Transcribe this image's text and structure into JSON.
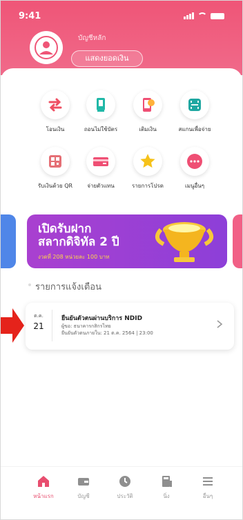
{
  "status_bar": {
    "time": "9:41"
  },
  "account": {
    "label": "บัญชีหลัก",
    "show_balance_button": "แสดงยอดเงิน"
  },
  "menu_items": [
    {
      "label": "โอนเงิน",
      "icon": "transfer-icon",
      "color": "#ef4f62"
    },
    {
      "label": "ถอนไม่ใช้บัตร",
      "icon": "cardless-withdraw-icon",
      "color": "#20b8a7"
    },
    {
      "label": "เติมเงิน",
      "icon": "topup-phone-icon",
      "color": "#ff7d4a"
    },
    {
      "label": "สแกนเพื่อจ่าย",
      "icon": "scan-to-pay-icon",
      "color": "#1fa7a1"
    },
    {
      "label": "รับเงินด้วย QR",
      "icon": "qr-receive-icon",
      "color": "#e56f75"
    },
    {
      "label": "จ่ายตัวแทน",
      "icon": "bill-pay-icon",
      "color": "#ef4f74"
    },
    {
      "label": "รายการโปรด",
      "icon": "star-icon",
      "color": "#f6c21a"
    },
    {
      "label": "เมนูอื่นๆ",
      "icon": "more-icon",
      "color": "#ef4f74"
    }
  ],
  "banner": {
    "title_line1": "เปิดรับฝาก",
    "title_line2": "สลากดิจิทัล 2 ปี",
    "subtitle": "งวดที่ 208 หน่วยละ 100 บาท"
  },
  "notifications": {
    "section_title": "รายการแจ้งเตือน",
    "items": [
      {
        "month": "ต.ค.",
        "day": "21",
        "title": "ยืนยันตัวตนผ่านบริการ NDID",
        "from": "ผู้ขอ: ธนาคารกสิกรไทย",
        "deadline": "ยืนยันตัวตนภายใน: 21 ต.ค. 2564 | 23:00"
      }
    ]
  },
  "tab_bar": {
    "items": [
      {
        "label": "หน้าแรก",
        "icon": "home-icon",
        "active": true
      },
      {
        "label": "บัญชี",
        "icon": "wallet-icon",
        "active": false
      },
      {
        "label": "ประวัติ",
        "icon": "history-icon",
        "active": false
      },
      {
        "label": "นิ่ง",
        "icon": "calculator-icon",
        "active": false
      },
      {
        "label": "อื่นๆ",
        "icon": "menu-icon",
        "active": false
      }
    ]
  },
  "colors": {
    "primary": "#ef5577",
    "accent_purple": "#9b44d6",
    "arrow_red": "#e5231b"
  }
}
